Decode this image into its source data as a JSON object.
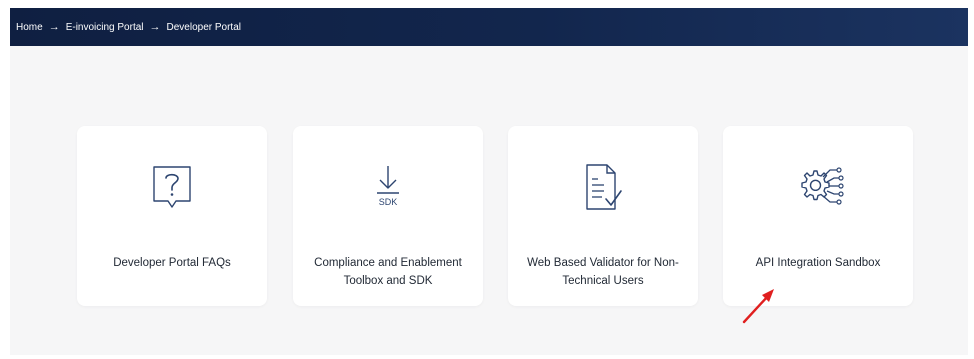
{
  "breadcrumb": {
    "items": [
      {
        "label": "Home"
      },
      {
        "label": "E-invoicing Portal"
      },
      {
        "label": "Developer Portal"
      }
    ],
    "separator": "→"
  },
  "cards": [
    {
      "label": "Developer Portal FAQs",
      "icon": "question-help-icon"
    },
    {
      "label": "Compliance and Enablement Toolbox and SDK",
      "icon": "download-sdk-icon",
      "icon_text": "SDK"
    },
    {
      "label": "Web Based Validator for Non-Technical Users",
      "icon": "document-check-icon"
    },
    {
      "label": "API Integration Sandbox",
      "icon": "gear-circuit-icon"
    }
  ],
  "colors": {
    "header_bg": "#12264d",
    "page_bg": "#f6f6f7",
    "card_bg": "#ffffff",
    "icon_stroke": "#2d4570",
    "annotation_arrow": "#e01f1f"
  }
}
